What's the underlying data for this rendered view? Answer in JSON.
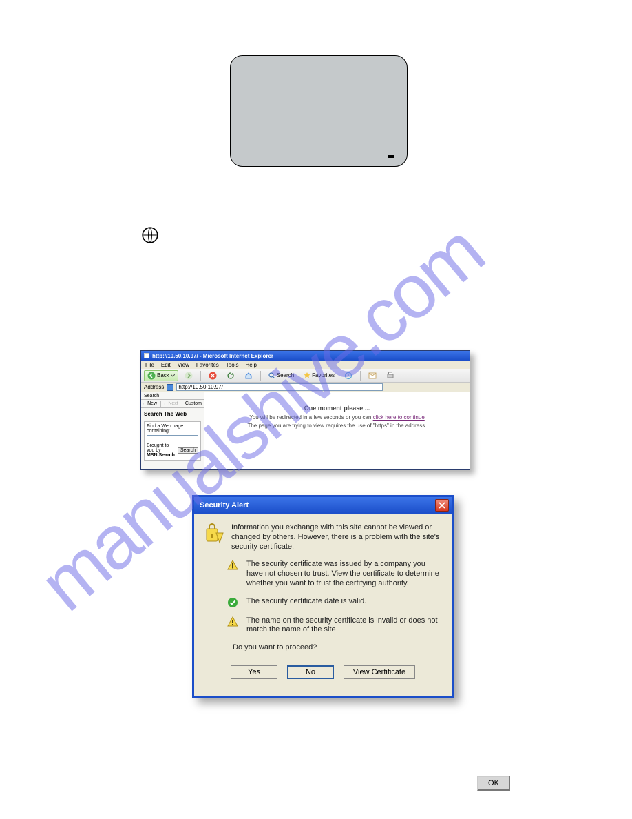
{
  "watermark": "manualshive.com",
  "ie": {
    "window_title": "http://10.50.10.97/ - Microsoft Internet Explorer",
    "menu": {
      "file": "File",
      "edit": "Edit",
      "view": "View",
      "favorites": "Favorites",
      "tools": "Tools",
      "help": "Help"
    },
    "toolbar": {
      "back": "Back",
      "search": "Search",
      "favorites": "Favorites"
    },
    "address_label": "Address",
    "address_value": "http://10.50.10.97/",
    "side": {
      "tab_search": "Search",
      "row_new": "New",
      "row_next": "Next",
      "row_custom": "Custom",
      "heading": "Search The Web",
      "find_label": "Find a Web page containing:",
      "find_value": "",
      "provider_line1": "Brought to you by",
      "provider_line2": "MSN Search",
      "search_button": "Search"
    },
    "main": {
      "heading": "One moment please ...",
      "redirect_prefix": "You will be redirected in a few seconds or you can ",
      "redirect_link": "click here to continue",
      "https_note": "The page you are trying to view requires the use of \"https\" in the address."
    }
  },
  "dialog": {
    "title": "Security Alert",
    "intro": "Information you exchange with this site cannot be viewed or changed by others. However, there is a problem with the site's security certificate.",
    "bullet1": "The security certificate was issued by a company you have not chosen to trust. View the certificate to determine whether you want to trust the certifying authority.",
    "bullet2": "The security certificate date is valid.",
    "bullet3": "The name on the security certificate is invalid or does not match the name of the site",
    "proceed": "Do you want to proceed?",
    "yes": "Yes",
    "no": "No",
    "view_cert": "View Certificate"
  },
  "ok_button": "OK"
}
